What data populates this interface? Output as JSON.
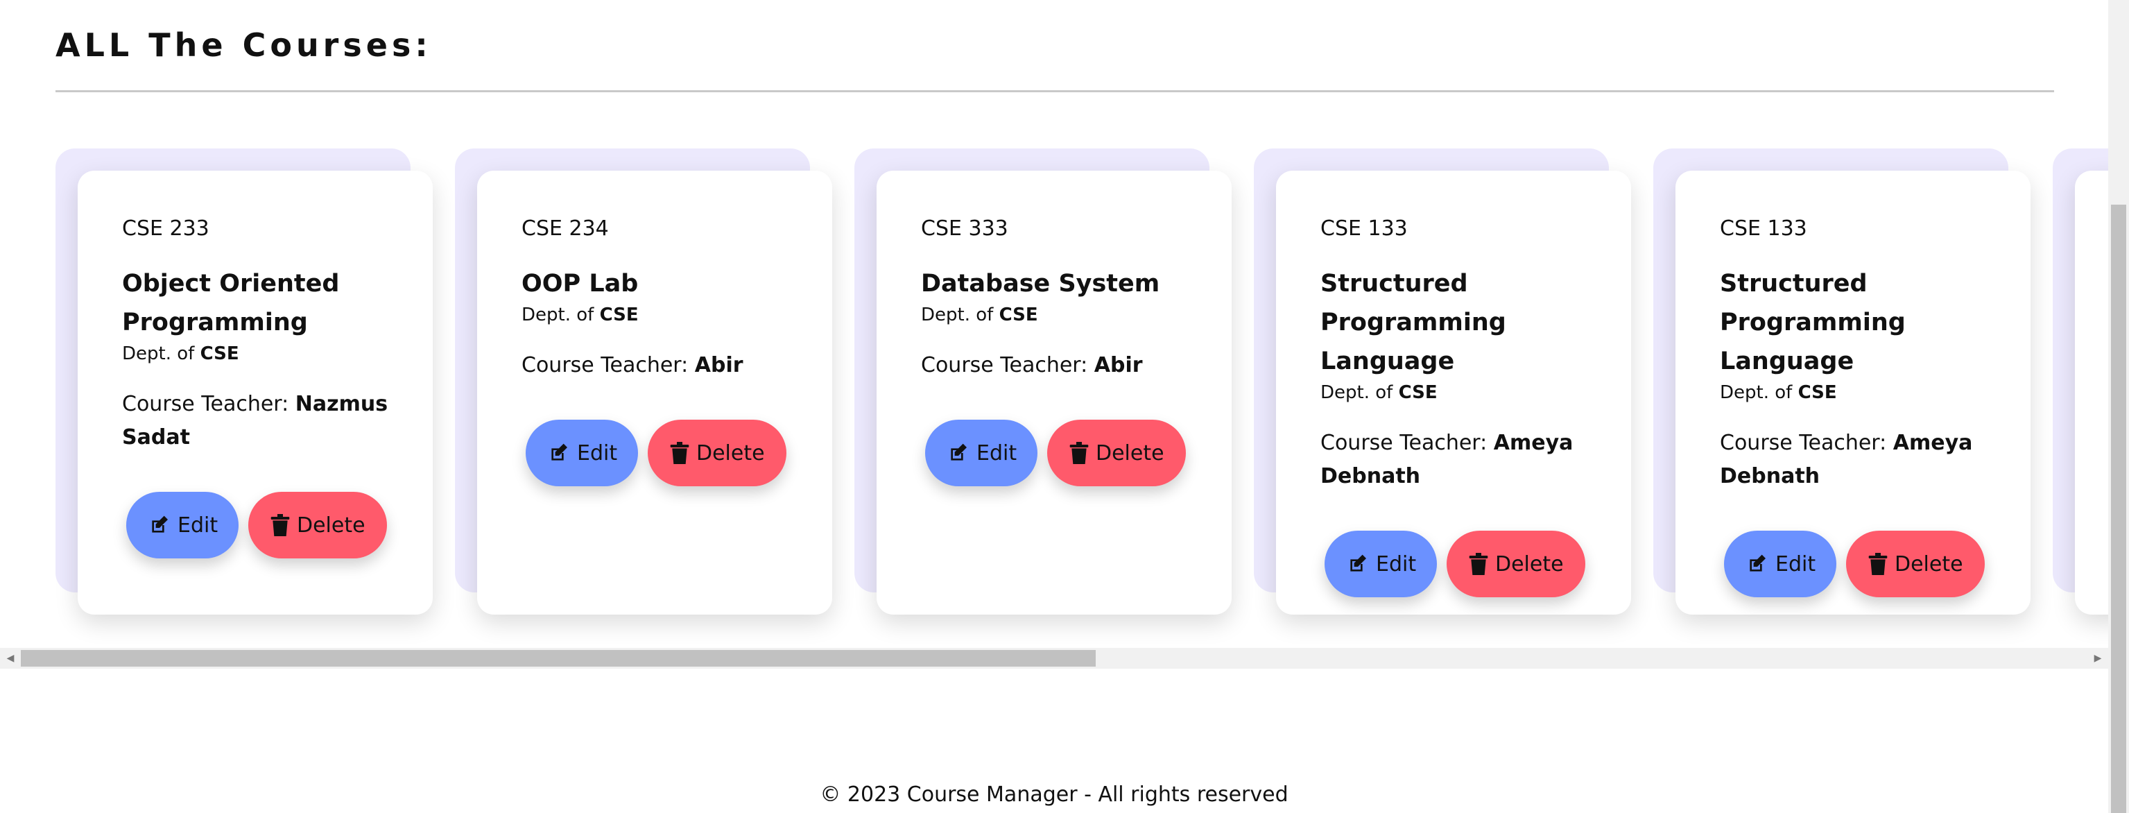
{
  "page": {
    "title": "ALL The Courses:"
  },
  "courses": [
    {
      "code": "CSE 233",
      "name": "Object Oriented Programming",
      "dept_prefix": "Dept. of",
      "dept": "CSE",
      "teacher_label": "Course Teacher:",
      "teacher": "Nazmus Sadat",
      "edit_label": "Edit",
      "delete_label": "Delete"
    },
    {
      "code": "CSE 234",
      "name": "OOP Lab",
      "dept_prefix": "Dept. of",
      "dept": "CSE",
      "teacher_label": "Course Teacher:",
      "teacher": "Abir",
      "edit_label": "Edit",
      "delete_label": "Delete"
    },
    {
      "code": "CSE 333",
      "name": "Database System",
      "dept_prefix": "Dept. of",
      "dept": "CSE",
      "teacher_label": "Course Teacher:",
      "teacher": "Abir",
      "edit_label": "Edit",
      "delete_label": "Delete"
    },
    {
      "code": "CSE 133",
      "name": "Structured Programming Language",
      "dept_prefix": "Dept. of",
      "dept": "CSE",
      "teacher_label": "Course Teacher:",
      "teacher": "Ameya Debnath",
      "edit_label": "Edit",
      "delete_label": "Delete"
    },
    {
      "code": "CSE 133",
      "name": "Structured Programming Language",
      "dept_prefix": "Dept. of",
      "dept": "CSE",
      "teacher_label": "Course Teacher:",
      "teacher": "Ameya Debnath",
      "edit_label": "Edit",
      "delete_label": "Delete"
    }
  ],
  "icons": {
    "edit": "edit-icon",
    "delete": "trash-icon"
  },
  "colors": {
    "edit_button": "#6b91ff",
    "delete_button": "#ff5a6b",
    "card_backdrop": "#ece9fd"
  },
  "horizontal_scroll": {
    "visible_fraction": 0.51,
    "position": 0
  },
  "footer": {
    "text": "© 2023 Course Manager - All rights reserved"
  }
}
